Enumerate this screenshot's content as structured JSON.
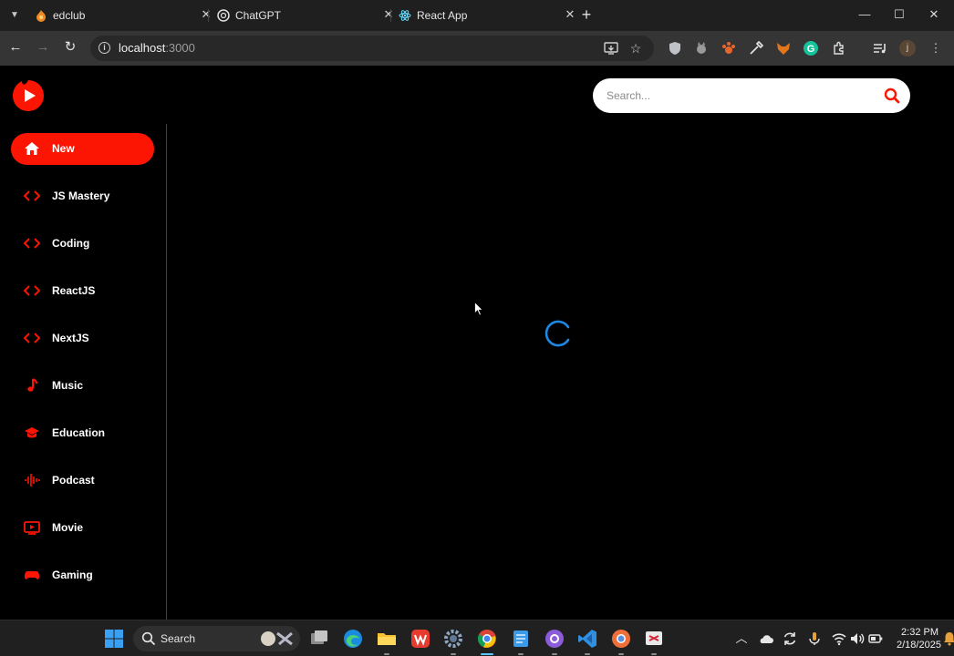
{
  "browser": {
    "tabs": [
      {
        "title": "edclub",
        "favicon": "edclub-icon"
      },
      {
        "title": "ChatGPT",
        "favicon": "chatgpt-icon"
      },
      {
        "title": "React App",
        "favicon": "react-icon",
        "active": true
      }
    ],
    "url_host": "localhost",
    "url_port": ":3000"
  },
  "app": {
    "search": {
      "placeholder": "Search..."
    },
    "categories": [
      {
        "label": "New",
        "icon": "home-icon",
        "active": true
      },
      {
        "label": "JS Mastery",
        "icon": "code-icon"
      },
      {
        "label": "Coding",
        "icon": "code-icon"
      },
      {
        "label": "ReactJS",
        "icon": "code-icon"
      },
      {
        "label": "NextJS",
        "icon": "code-icon"
      },
      {
        "label": "Music",
        "icon": "music-note-icon"
      },
      {
        "label": "Education",
        "icon": "graduation-cap-icon"
      },
      {
        "label": "Podcast",
        "icon": "podcast-icon"
      },
      {
        "label": "Movie",
        "icon": "tv-icon"
      },
      {
        "label": "Gaming",
        "icon": "gamepad-icon"
      }
    ],
    "accent_color": "#fc1503",
    "loading": true
  },
  "taskbar": {
    "search_label": "Search",
    "time": "2:32 PM",
    "date": "2/18/2025"
  }
}
